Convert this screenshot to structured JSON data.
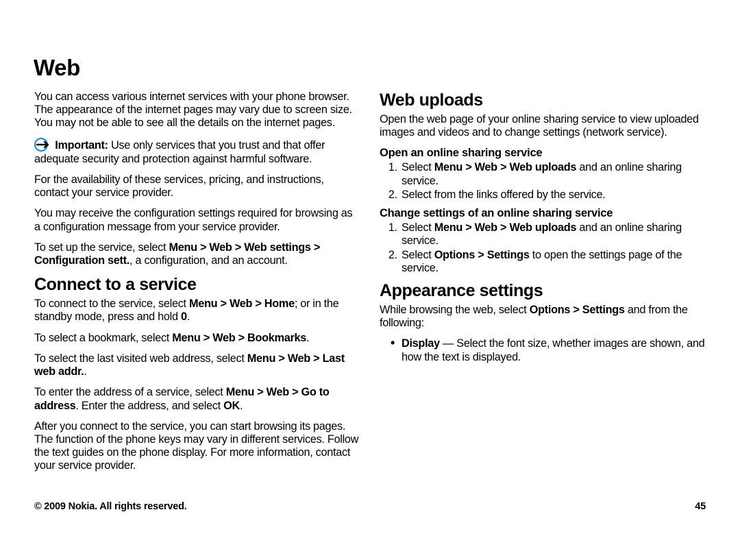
{
  "title": "Web",
  "intro": "You can access various internet services with your phone browser. The appearance of the internet pages may vary due to screen size. You may not be able to see all the details on the internet pages.",
  "important_label": "Important:",
  "important_text": "  Use only services that you trust and that offer adequate security and protection against harmful software.",
  "avail": "For the availability of these services, pricing, and instructions, contact your service provider.",
  "config": "You may receive the configuration settings required for browsing as a configuration message from your service provider.",
  "setup_pre": "To set up the service, select ",
  "setup_bold": "Menu  >  Web  >  Web settings  >  Configuration sett.",
  "setup_post": ", a configuration, and an account.",
  "connect_h": "Connect to a service",
  "connect_p1_pre": "To connect to the service, select ",
  "connect_p1_b1": "Menu  >  Web  >  Home",
  "connect_p1_mid": "; or in the standby mode, press and hold ",
  "connect_p1_b2": "0",
  "connect_p1_post": ".",
  "connect_p2_pre": "To select a bookmark, select ",
  "connect_p2_b": "Menu  >  Web  >  Bookmarks",
  "connect_p2_post": ".",
  "connect_p3_pre": "To select the last visited web address, select ",
  "connect_p3_b": "Menu  >  Web  > Last web addr.",
  "connect_p3_post": ".",
  "connect_p4_pre": "To enter the address of a service, select ",
  "connect_p4_b1": "Menu  >  Web  >  Go to address",
  "connect_p4_mid": ". Enter the address, and select ",
  "connect_p4_b2": "OK",
  "connect_p4_post": ".",
  "after": "After you connect to the service, you can start browsing its pages. The function of the phone keys may vary in different services. Follow the text guides on the phone display. For more information, contact your service provider.",
  "uploads_h": "Web uploads",
  "uploads_intro": "Open the web page of your online sharing service to view uploaded images and videos and to change settings (network service).",
  "open_h": "Open an online sharing service",
  "open_li1_pre": "Select ",
  "open_li1_b": "Menu  >  Web  >  Web uploads",
  "open_li1_post": " and an online sharing service.",
  "open_li2": "Select from the links offered by the service.",
  "change_h": "Change settings of an online sharing service",
  "change_li1_pre": "Select ",
  "change_li1_b": "Menu  >  Web  >  Web uploads",
  "change_li1_post": " and an online sharing service.",
  "change_li2_pre": "Select ",
  "change_li2_b": "Options  >  Settings",
  "change_li2_post": " to open the settings page of the service.",
  "appear_h": "Appearance settings",
  "appear_intro_pre": "While browsing the web, select ",
  "appear_intro_b": "Options  >  Settings",
  "appear_intro_post": " and from the following:",
  "appear_li_b": "Display",
  "appear_li_post": "  — Select the font size, whether images are shown, and how the text is displayed.",
  "footer_left": "© 2009 Nokia. All rights reserved.",
  "footer_right": "45"
}
